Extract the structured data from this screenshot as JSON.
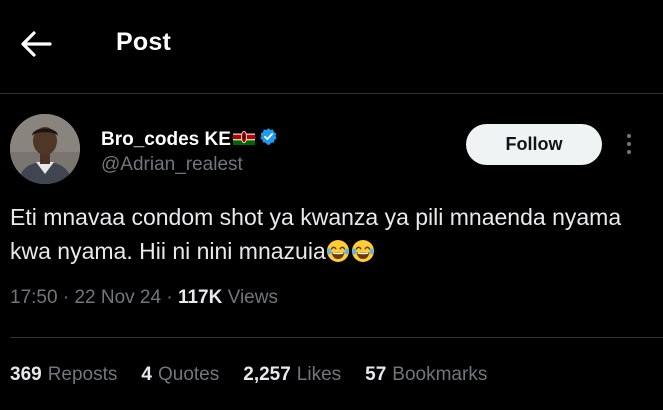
{
  "header": {
    "title": "Post",
    "back_icon": "arrow-left-icon"
  },
  "author": {
    "display_name": "Bro_codes KE",
    "flag_icon": "kenya-flag-icon",
    "verified_icon": "verified-badge-icon",
    "handle": "@Adrian_realest",
    "follow_label": "Follow",
    "more_icon": "more-vertical-icon"
  },
  "tweet": {
    "text": "Eti mnavaa condom shot ya kwanza ya pili mnaenda nyama kwa nyama. Hii ni nini mnazuia",
    "emojis": [
      "laughing-tears-emoji",
      "laughing-tears-emoji"
    ]
  },
  "meta": {
    "time": "17:50",
    "separator": "·",
    "date": "22 Nov 24",
    "views_count": "117K",
    "views_label": "Views"
  },
  "stats": [
    {
      "count": "369",
      "label": "Reposts"
    },
    {
      "count": "4",
      "label": "Quotes"
    },
    {
      "count": "2,257",
      "label": "Likes"
    },
    {
      "count": "57",
      "label": "Bookmarks"
    }
  ],
  "colors": {
    "background": "#000000",
    "text": "#e7e9ea",
    "secondary": "#71767b",
    "divider": "#2f3336",
    "verified": "#1d9bf0",
    "follow_bg": "#eff3f4"
  }
}
